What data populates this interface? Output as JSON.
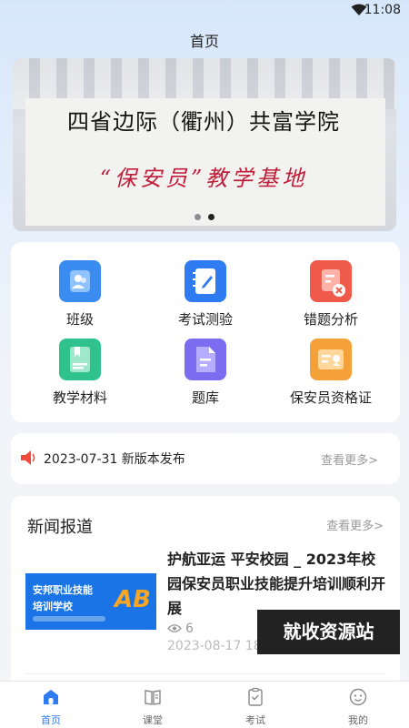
{
  "status_bar": {
    "time": "11:08",
    "wifi_icon": "wifi-icon"
  },
  "page": {
    "title": "首页"
  },
  "banner": {
    "line1": "四省边际（衢州）共富学院",
    "line2": "“保安员”教学基地",
    "slide_count": 2,
    "active_slide": 2
  },
  "grid": {
    "items": [
      {
        "label": "班级",
        "icon": "class-icon",
        "color": "#3b8cf0"
      },
      {
        "label": "考试测验",
        "icon": "exam-notebook-icon",
        "color": "#2f7bf2"
      },
      {
        "label": "错题分析",
        "icon": "wrong-answer-icon",
        "color": "#ef5a4a"
      },
      {
        "label": "教学材料",
        "icon": "teaching-material-icon",
        "color": "#2fc28f"
      },
      {
        "label": "题库",
        "icon": "question-bank-icon",
        "color": "#7c6cf0"
      },
      {
        "label": "保安员资格证",
        "icon": "certificate-icon",
        "color": "#f5a13a"
      }
    ]
  },
  "notice": {
    "text": "2023-07-31 新版本发布",
    "more": "查看更多>",
    "icon": "speaker-icon"
  },
  "news": {
    "heading": "新闻报道",
    "more": "查看更多>",
    "item": {
      "headline": "护航亚运 平安校园 _ 2023年校园保安员职业技能提升培训顺利开展",
      "views": "6",
      "date": "2023-08-17 18",
      "thumb_line1": "安邦职业技能",
      "thumb_line2": "培训学校",
      "thumb_logo": "AB"
    }
  },
  "watermark": "就收资源站",
  "tabbar": {
    "tabs": [
      {
        "label": "首页",
        "icon": "home-icon",
        "active": true
      },
      {
        "label": "课堂",
        "icon": "classroom-icon",
        "active": false
      },
      {
        "label": "考试",
        "icon": "exam-icon",
        "active": false
      },
      {
        "label": "我的",
        "icon": "profile-icon",
        "active": false
      }
    ]
  }
}
